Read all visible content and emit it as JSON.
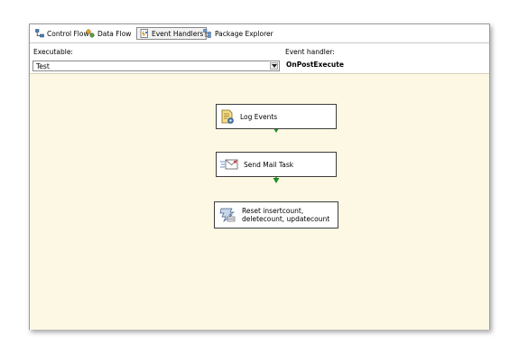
{
  "tabs": [
    {
      "label": "Control Flow",
      "icon": "control-flow-icon",
      "active": false
    },
    {
      "label": "Data Flow",
      "icon": "data-flow-icon",
      "active": false
    },
    {
      "label": "Event Handlers",
      "icon": "event-handlers-icon",
      "active": true
    },
    {
      "label": "Package Explorer",
      "icon": "package-explorer-icon",
      "active": false
    }
  ],
  "executable": {
    "label": "Executable:",
    "value": "Test"
  },
  "event_handler": {
    "label": "Event handler:",
    "value": "OnPostExecute"
  },
  "tasks": [
    {
      "label": "Log Events",
      "icon": "script-task-icon"
    },
    {
      "label": "Send Mail Task",
      "icon": "send-mail-icon"
    },
    {
      "label": "Reset insertcount, deletecount, updatecount",
      "icon": "execute-sql-icon"
    }
  ],
  "colors": {
    "canvas_background": "#fdf8e4",
    "precedence_constraint": "#1e8c1e",
    "active_tab_border": "#8a8a8a"
  }
}
